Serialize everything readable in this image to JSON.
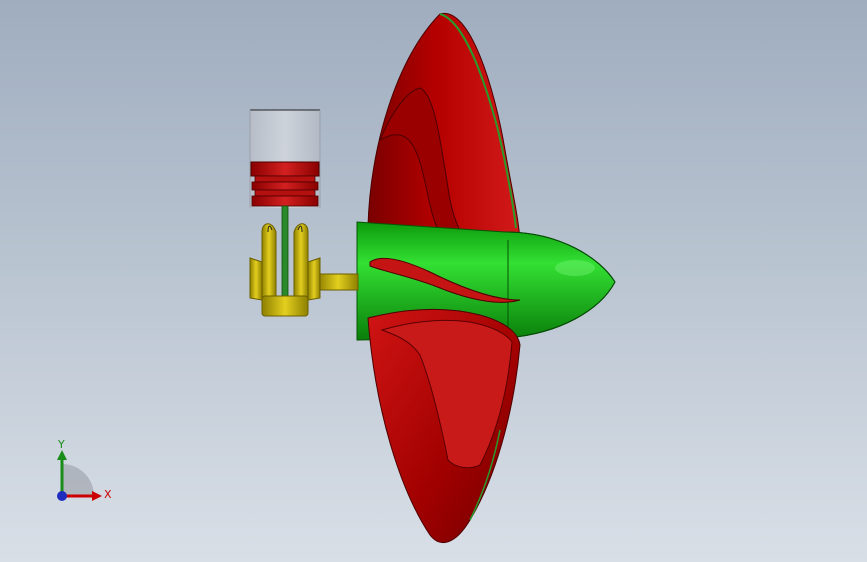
{
  "triad": {
    "x_label": "X",
    "y_label": "Y"
  },
  "colors": {
    "background_top": "#9fadbf",
    "background_bottom": "#d9dfe7",
    "blade_red": "#b30000",
    "hub_green": "#1ec81e",
    "piston_yellow": "#c8b400",
    "cylinder_gray": "#c7cbd3",
    "axis_x": "#cc0000",
    "axis_y": "#1a8c1a",
    "axis_z": "#1f2dbf"
  }
}
